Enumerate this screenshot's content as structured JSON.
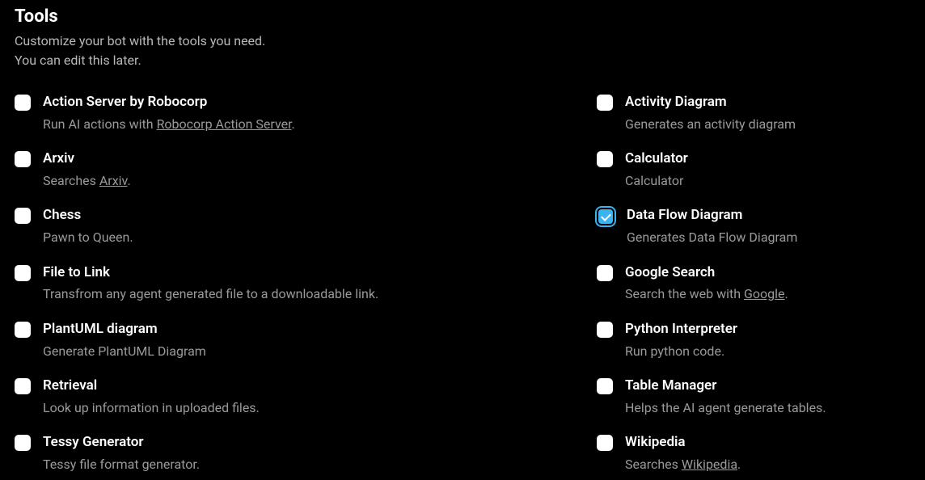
{
  "header": {
    "title": "Tools",
    "subtitle_line1": "Customize your bot with the tools you need.",
    "subtitle_line2": "You can edit this later."
  },
  "left_tools": [
    {
      "id": "action-server",
      "checked": false,
      "title": "Action Server by Robocorp",
      "desc_prefix": "Run AI actions with ",
      "desc_link": "Robocorp Action Server",
      "desc_suffix": "."
    },
    {
      "id": "arxiv",
      "checked": false,
      "title": "Arxiv",
      "desc_prefix": "Searches ",
      "desc_link": "Arxiv",
      "desc_suffix": "."
    },
    {
      "id": "chess",
      "checked": false,
      "title": "Chess",
      "desc_prefix": "Pawn to Queen.",
      "desc_link": "",
      "desc_suffix": ""
    },
    {
      "id": "file-to-link",
      "checked": false,
      "title": "File to Link",
      "desc_prefix": "Transfrom any agent generated file to a downloadable link.",
      "desc_link": "",
      "desc_suffix": ""
    },
    {
      "id": "plantuml",
      "checked": false,
      "title": "PlantUML diagram",
      "desc_prefix": "Generate PlantUML Diagram",
      "desc_link": "",
      "desc_suffix": ""
    },
    {
      "id": "retrieval",
      "checked": false,
      "title": "Retrieval",
      "desc_prefix": "Look up information in uploaded files.",
      "desc_link": "",
      "desc_suffix": ""
    },
    {
      "id": "tessy",
      "checked": false,
      "title": "Tessy Generator",
      "desc_prefix": "Tessy file format generator.",
      "desc_link": "",
      "desc_suffix": ""
    }
  ],
  "right_tools": [
    {
      "id": "activity-diagram",
      "checked": false,
      "title": "Activity Diagram",
      "desc_prefix": "Generates an activity diagram",
      "desc_link": "",
      "desc_suffix": ""
    },
    {
      "id": "calculator",
      "checked": false,
      "title": "Calculator",
      "desc_prefix": "Calculator",
      "desc_link": "",
      "desc_suffix": ""
    },
    {
      "id": "data-flow-diagram",
      "checked": true,
      "title": "Data Flow Diagram",
      "desc_prefix": "Generates Data Flow Diagram",
      "desc_link": "",
      "desc_suffix": ""
    },
    {
      "id": "google-search",
      "checked": false,
      "title": "Google Search",
      "desc_prefix": "Search the web with ",
      "desc_link": "Google",
      "desc_suffix": "."
    },
    {
      "id": "python-interpreter",
      "checked": false,
      "title": "Python Interpreter",
      "desc_prefix": "Run python code.",
      "desc_link": "",
      "desc_suffix": ""
    },
    {
      "id": "table-manager",
      "checked": false,
      "title": "Table Manager",
      "desc_prefix": "Helps the AI agent generate tables.",
      "desc_link": "",
      "desc_suffix": ""
    },
    {
      "id": "wikipedia",
      "checked": false,
      "title": "Wikipedia",
      "desc_prefix": "Searches ",
      "desc_link": "Wikipedia",
      "desc_suffix": "."
    }
  ]
}
